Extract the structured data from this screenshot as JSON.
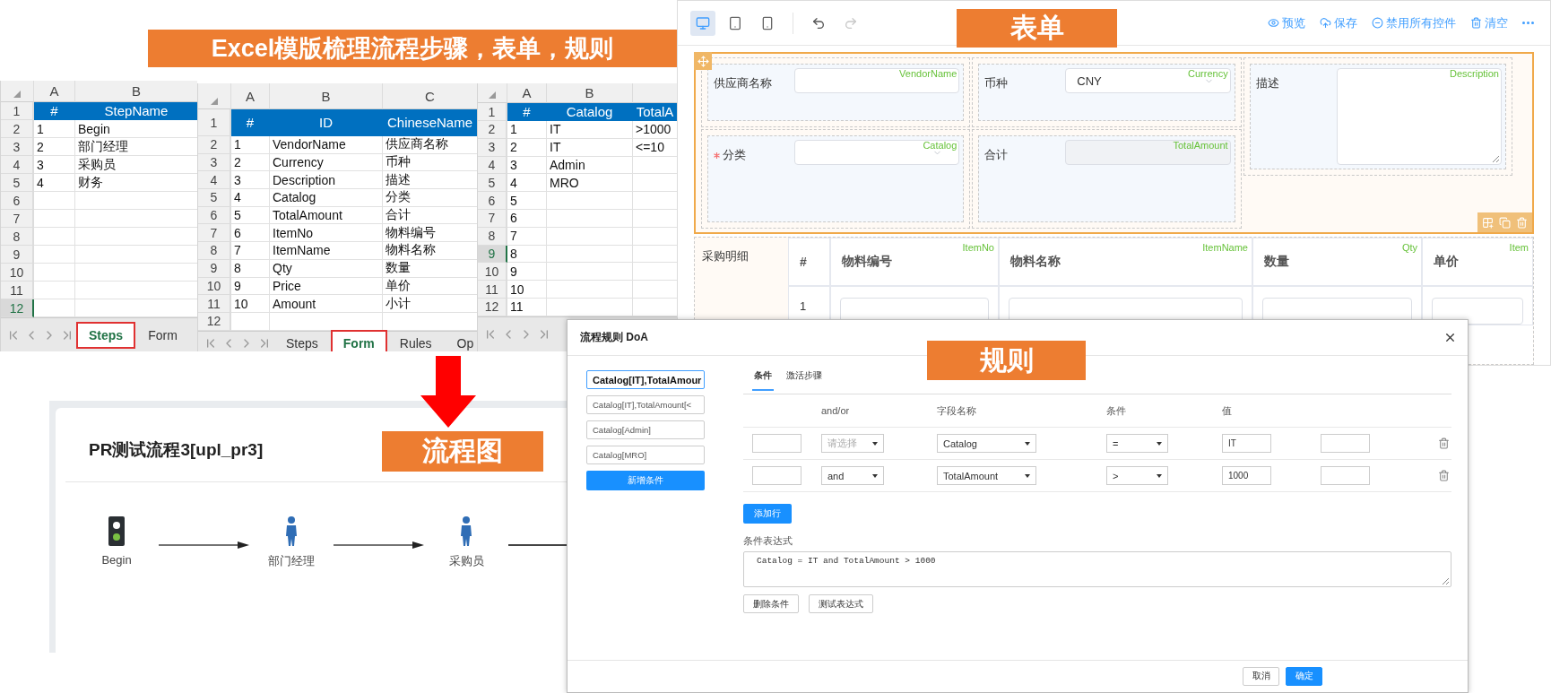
{
  "banner": {
    "text": "Excel模版梳理流程步骤，表单，规则"
  },
  "sheets": [
    {
      "columns": [
        "A",
        "B"
      ],
      "rows": [
        {
          "n": "1",
          "kind": "header",
          "cells": [
            "#",
            "StepName"
          ],
          "selected": false
        },
        {
          "n": "2",
          "kind": "data",
          "cells": [
            "1",
            "Begin"
          ],
          "selected": false
        },
        {
          "n": "3",
          "kind": "data",
          "cells": [
            "2",
            "部门经理"
          ],
          "selected": false
        },
        {
          "n": "4",
          "kind": "data",
          "cells": [
            "3",
            "采购员"
          ],
          "selected": false
        },
        {
          "n": "5",
          "kind": "data",
          "cells": [
            "4",
            "财务"
          ],
          "selected": false
        },
        {
          "n": "6",
          "kind": "data",
          "selected": false
        },
        {
          "n": "7",
          "kind": "data",
          "selected": false
        },
        {
          "n": "8",
          "kind": "data",
          "selected": false
        },
        {
          "n": "9",
          "kind": "data",
          "selected": false
        },
        {
          "n": "10",
          "kind": "data",
          "selected": false
        },
        {
          "n": "11",
          "kind": "data",
          "selected": false
        },
        {
          "n": "12",
          "kind": "data",
          "selected": true
        }
      ],
      "tabs": [
        {
          "label": "Steps",
          "selected": true
        },
        {
          "label": "Form",
          "selected": false
        }
      ]
    },
    {
      "columns": [
        "A",
        "B",
        "C"
      ],
      "rows": [
        {
          "n": "1",
          "kind": "header",
          "cells": [
            "#",
            "ID",
            "ChineseName"
          ],
          "selected": false
        },
        {
          "n": "2",
          "kind": "data",
          "cells": [
            "1",
            "VendorName",
            "供应商名称"
          ],
          "selected": false
        },
        {
          "n": "3",
          "kind": "data",
          "cells": [
            "2",
            "Currency",
            "币种"
          ],
          "selected": false
        },
        {
          "n": "4",
          "kind": "data",
          "cells": [
            "3",
            "Description",
            "描述"
          ],
          "selected": false
        },
        {
          "n": "5",
          "kind": "data",
          "cells": [
            "4",
            "Catalog",
            "分类"
          ],
          "selected": false
        },
        {
          "n": "6",
          "kind": "data",
          "cells": [
            "5",
            "TotalAmount",
            "合计"
          ],
          "selected": false
        },
        {
          "n": "7",
          "kind": "data",
          "cells": [
            "6",
            "ItemNo",
            "物料编号"
          ],
          "selected": false
        },
        {
          "n": "8",
          "kind": "data",
          "cells": [
            "7",
            "ItemName",
            "物料名称"
          ],
          "selected": false
        },
        {
          "n": "9",
          "kind": "data",
          "cells": [
            "8",
            "Qty",
            "数量"
          ],
          "selected": false
        },
        {
          "n": "10",
          "kind": "data",
          "cells": [
            "9",
            "Price",
            "单价"
          ],
          "selected": false
        },
        {
          "n": "11",
          "kind": "data",
          "cells": [
            "10",
            "Amount",
            "小计"
          ],
          "selected": false
        },
        {
          "n": "12",
          "kind": "data",
          "selected": false
        }
      ],
      "tabs": [
        {
          "label": "Steps",
          "selected": false
        },
        {
          "label": "Form",
          "selected": true
        },
        {
          "label": "Rules",
          "selected": false
        },
        {
          "label": "Op",
          "selected": false
        }
      ]
    },
    {
      "columns": [
        "A",
        "B"
      ],
      "rows": [
        {
          "n": "1",
          "kind": "header",
          "cells": [
            "#",
            "Catalog",
            "TotalA"
          ],
          "selected": false
        },
        {
          "n": "2",
          "kind": "data",
          "cells": [
            "1",
            "IT",
            ">1000"
          ],
          "selected": false
        },
        {
          "n": "3",
          "kind": "data",
          "cells": [
            "2",
            "IT",
            "<=10"
          ],
          "selected": false
        },
        {
          "n": "4",
          "kind": "data",
          "cells": [
            "3",
            "Admin"
          ],
          "selected": false
        },
        {
          "n": "5",
          "kind": "data",
          "cells": [
            "4",
            "MRO"
          ],
          "selected": false
        },
        {
          "n": "6",
          "kind": "data",
          "cells": [
            "5"
          ],
          "selected": false
        },
        {
          "n": "7",
          "kind": "data",
          "cells": [
            "6"
          ],
          "selected": false
        },
        {
          "n": "8",
          "kind": "data",
          "cells": [
            "7"
          ],
          "selected": false
        },
        {
          "n": "9",
          "kind": "data",
          "cells": [
            "8"
          ],
          "selected": true
        },
        {
          "n": "10",
          "kind": "data",
          "cells": [
            "9"
          ],
          "selected": false
        },
        {
          "n": "11",
          "kind": "data",
          "cells": [
            "10"
          ],
          "selected": false
        },
        {
          "n": "12",
          "kind": "data",
          "cells": [
            "11"
          ],
          "selected": false
        }
      ]
    }
  ],
  "form": {
    "banner": "表单",
    "devices": [
      {
        "kind": "desktop",
        "selected": true
      },
      {
        "kind": "tablet",
        "selected": false
      },
      {
        "kind": "phone",
        "selected": false
      }
    ],
    "history": [
      {
        "kind": "undo",
        "disabled": false
      },
      {
        "kind": "redo",
        "disabled": true
      }
    ],
    "actions": [
      {
        "kind": "preview",
        "label": "预览"
      },
      {
        "kind": "save",
        "label": "保存"
      },
      {
        "kind": "disable",
        "label": "禁用所有控件"
      },
      {
        "kind": "clear",
        "label": "清空"
      },
      {
        "kind": "more"
      }
    ],
    "fields": [
      {
        "label": "供应商名称",
        "field_id": "VendorName",
        "kind": "text",
        "required": false,
        "disabled": false
      },
      {
        "label": "币种",
        "field_id": "Currency",
        "kind": "select",
        "value": "CNY",
        "required": false,
        "disabled": false
      },
      {
        "label": "描述",
        "field_id": "Description",
        "kind": "textarea",
        "required": false,
        "disabled": false
      },
      {
        "label": "分类",
        "field_id": "Catalog",
        "kind": "select",
        "required": true,
        "disabled": false
      },
      {
        "label": "合计",
        "field_id": "TotalAmount",
        "kind": "text",
        "required": false,
        "disabled": true
      }
    ],
    "subtable": {
      "label": "采购明细",
      "columns": [
        {
          "label": "#"
        },
        {
          "label": "物料编号",
          "field_id": "ItemNo"
        },
        {
          "label": "物料名称",
          "field_id": "ItemName"
        },
        {
          "label": "数量",
          "field_id": "Qty"
        },
        {
          "label": "单价",
          "field_id": "Item"
        }
      ],
      "rows": [
        {
          "n": "1"
        }
      ]
    }
  },
  "flow": {
    "title": "PR测试流程3[upl_pr3]",
    "banner": "流程图",
    "nodes": [
      {
        "kind": "start",
        "label": "Begin"
      },
      {
        "kind": "person",
        "label": "部门经理"
      },
      {
        "kind": "person",
        "label": "采购员"
      }
    ]
  },
  "rules": {
    "title": "流程规则 DoA",
    "banner": "规则",
    "conditions": [
      {
        "label": "Catalog[IT],TotalAmour",
        "selected": true
      },
      {
        "label": "Catalog[IT],TotalAmount[<",
        "selected": false
      },
      {
        "label": "Catalog[Admin]",
        "selected": false
      },
      {
        "label": "Catalog[MRO]",
        "selected": false
      }
    ],
    "add_condition": "新增条件",
    "tabs": [
      {
        "label": "条件",
        "selected": true
      },
      {
        "label": "激活步骤",
        "selected": false
      }
    ],
    "columns": [
      "and/or",
      "字段名称",
      "条件",
      "值"
    ],
    "rows": [
      {
        "logic_placeholder": "请选择",
        "field": "Catalog",
        "operator": "=",
        "value": "IT"
      },
      {
        "logic": "and",
        "field": "TotalAmount",
        "operator": ">",
        "value": "1000"
      }
    ],
    "add_row": "添加行",
    "expression_label": "条件表达式",
    "expression": "Catalog = IT and TotalAmount > 1000",
    "buttons": [
      "删除条件",
      "测试表达式"
    ],
    "footer": [
      {
        "label": "取消",
        "primary": false
      },
      {
        "label": "确定",
        "primary": true
      }
    ]
  }
}
